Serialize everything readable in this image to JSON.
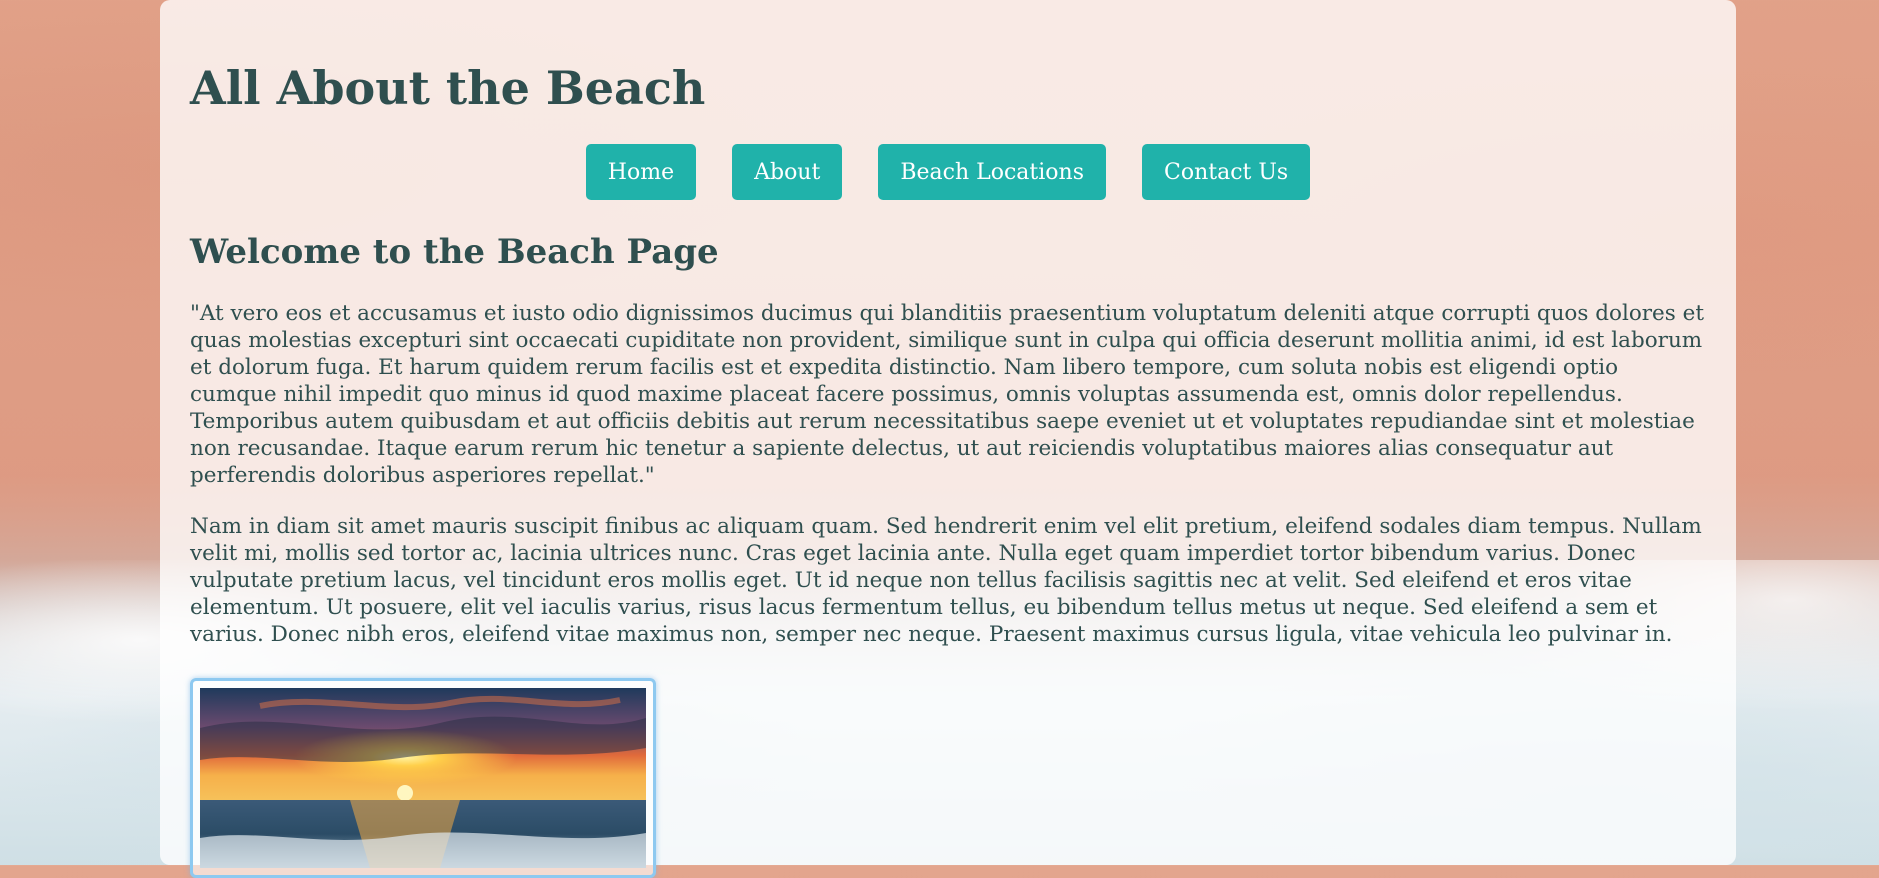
{
  "site": {
    "title": "All About the Beach"
  },
  "nav": {
    "items": [
      {
        "label": "Home"
      },
      {
        "label": "About"
      },
      {
        "label": "Beach Locations"
      },
      {
        "label": "Contact Us"
      }
    ]
  },
  "main": {
    "heading": "Welcome to the Beach Page",
    "paragraphs": [
      "\"At vero eos et accusamus et iusto odio dignissimos ducimus qui blanditiis praesentium voluptatum deleniti atque corrupti quos dolores et quas molestias excepturi sint occaecati cupiditate non provident, similique sunt in culpa qui officia deserunt mollitia animi, id est laborum et dolorum fuga. Et harum quidem rerum facilis est et expedita distinctio. Nam libero tempore, cum soluta nobis est eligendi optio cumque nihil impedit quo minus id quod maxime placeat facere possimus, omnis voluptas assumenda est, omnis dolor repellendus. Temporibus autem quibusdam et aut officiis debitis aut rerum necessitatibus saepe eveniet ut et voluptates repudiandae sint et molestiae non recusandae. Itaque earum rerum hic tenetur a sapiente delectus, ut aut reiciendis voluptatibus maiores alias consequatur aut perferendis doloribus asperiores repellat.\"",
      "Nam in diam sit amet mauris suscipit finibus ac aliquam quam. Sed hendrerit enim vel elit pretium, eleifend sodales diam tempus. Nullam velit mi, mollis sed tortor ac, lacinia ultrices nunc. Cras eget lacinia ante. Nulla eget quam imperdiet tortor bibendum varius. Donec vulputate pretium lacus, vel tincidunt eros mollis eget. Ut id neque non tellus facilisis sagittis nec at velit. Sed eleifend et eros vitae elementum. Ut posuere, elit vel iaculis varius, risus lacus fermentum tellus, eu bibendum tellus metus ut neque. Sed eleifend a sem et varius. Donec nibh eros, eleifend vitae maximus non, semper nec neque. Praesent maximus cursus ligula, vitae vehicula leo pulvinar in."
    ],
    "image": {
      "subject": "beach-sunset-photo"
    }
  },
  "colors": {
    "accent": "#20b2aa",
    "text": "#2f4f4f",
    "image_border": "#8ec9f0"
  }
}
